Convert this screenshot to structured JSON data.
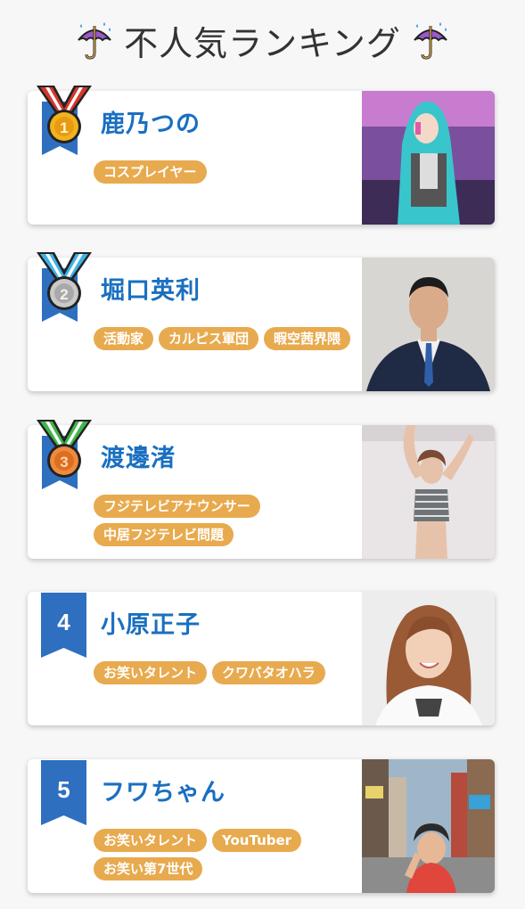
{
  "page": {
    "title": "不人気ランキング",
    "title_icon": "umbrella-with-rain-icon"
  },
  "colors": {
    "name_blue": "#1a6fc0",
    "tag_orange": "#e8aa4e",
    "ribbon_blue": "#2e6fc0"
  },
  "ranking": [
    {
      "rank": "1",
      "badge": "gold-medal-icon",
      "name": "鹿乃つの",
      "tags": [
        "コスプレイヤー"
      ],
      "photo": "cosplayer-photo"
    },
    {
      "rank": "2",
      "badge": "silver-medal-icon",
      "name": "堀口英利",
      "tags": [
        "活動家",
        "カルピス軍団",
        "暇空茜界隈"
      ],
      "photo": "man-in-suit-photo"
    },
    {
      "rank": "3",
      "badge": "bronze-medal-icon",
      "name": "渡邊渚",
      "tags": [
        "フジテレビアナウンサー",
        "中居フジテレビ問題"
      ],
      "photo": "woman-posing-photo"
    },
    {
      "rank": "4",
      "badge": "rank-ribbon",
      "name": "小原正子",
      "tags": [
        "お笑いタレント",
        "クワバタオハラ"
      ],
      "photo": "smiling-woman-photo"
    },
    {
      "rank": "5",
      "badge": "rank-ribbon",
      "name": "フワちゃん",
      "tags": [
        "お笑いタレント",
        "YouTuber",
        "お笑い第7世代"
      ],
      "photo": "city-street-photo"
    }
  ]
}
